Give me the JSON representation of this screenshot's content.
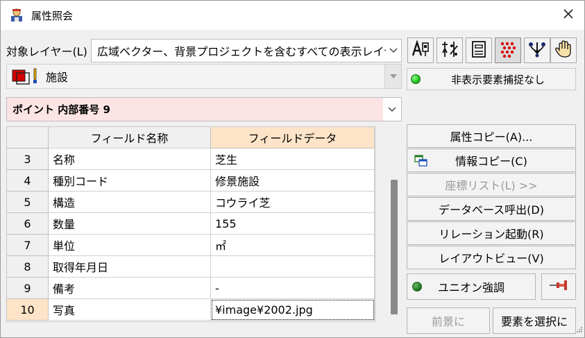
{
  "window": {
    "title": "属性照会"
  },
  "layer": {
    "label": "対象レイヤー(L)",
    "selected": "広域ベクター、背景プロジェクトを含むすべての表示レイヤー"
  },
  "feature_class": {
    "selected": "施設"
  },
  "status": {
    "text": "非表示要素捕捉なし"
  },
  "point": {
    "selected": "ポイント 内部番号 9"
  },
  "grid": {
    "headers": {
      "name": "フィールド名称",
      "data": "フィールドデータ"
    },
    "rows": [
      {
        "num": "3",
        "name": "名称",
        "value": "芝生"
      },
      {
        "num": "4",
        "name": "種別コード",
        "value": "修景施設"
      },
      {
        "num": "5",
        "name": "構造",
        "value": "コウライ芝"
      },
      {
        "num": "6",
        "name": "数量",
        "value": "155"
      },
      {
        "num": "7",
        "name": "単位",
        "value": "㎡"
      },
      {
        "num": "8",
        "name": "取得年月日",
        "value": ""
      },
      {
        "num": "9",
        "name": "備考",
        "value": "-"
      },
      {
        "num": "10",
        "name": "写真",
        "value": "¥image¥2002.jpg"
      }
    ]
  },
  "buttons": {
    "attr_copy": "属性コピー(A)...",
    "info_copy": "情報コピー(C)",
    "coord_list": "座標リスト(L) >>",
    "db_call": "データベース呼出(D)",
    "relation": "リレーション起動(R)",
    "layout_view": "レイアウトビュー(V)",
    "union_highlight": "ユニオン強調",
    "foreground": "前景に",
    "select_element": "要素を選択に"
  },
  "colors": {
    "point_highlight": "#fde4e4",
    "data_header": "#fde4c8",
    "status_led": "#19c219",
    "swatch_red": "#d40000"
  },
  "icons": {
    "toolbar": [
      "attribute-a-icon",
      "balance-scale-icon",
      "form-icon",
      "dot-grid-icon",
      "pick-arrow-icon",
      "hand-icon"
    ]
  }
}
